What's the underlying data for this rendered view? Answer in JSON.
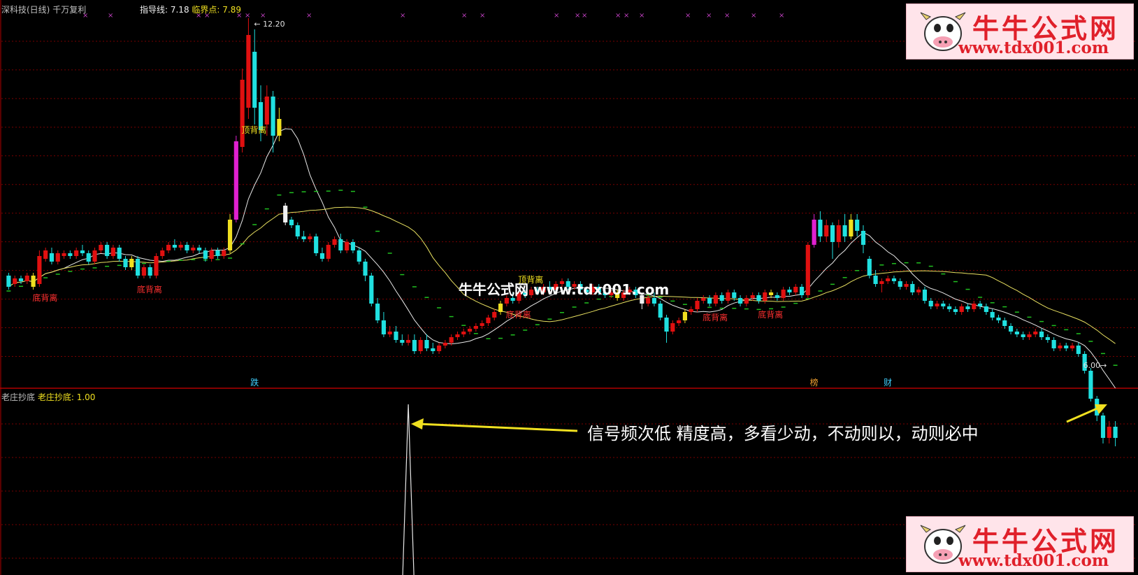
{
  "header": {
    "title": "深科技(日线)",
    "strategy": "千万复利",
    "guide_label": "指导线: 7.18",
    "critical_label": "临界点: 7.89"
  },
  "sub_panel": {
    "title": "老庄抄底",
    "indicator_label": "老庄抄底: 1.00"
  },
  "watermark": {
    "logo_cn": "牛牛公式网",
    "logo_url": "www.tdx001.com",
    "center_text": "牛牛公式网 www.tdx001.com"
  },
  "annotation_text": "信号频次低 精度高，多看少动，不动则以，动则必中",
  "colors": {
    "up": "#e01010",
    "down": "#20e0e0",
    "signal_yellow": "#f0e020",
    "signal_magenta": "#e020d0",
    "signal_white": "#f0f0f0",
    "ma_white": "#e8e8e8",
    "ma_yellow": "#e8e060",
    "ma_green": "#20c020",
    "grid": "#7a0000",
    "arrow": "#f0e020"
  },
  "chart_data": {
    "type": "candlestick",
    "price_range": [
      6.0,
      12.2
    ],
    "price_high_label": "12.20",
    "price_low_label": "6.00",
    "indicator_range": [
      0,
      1
    ],
    "indicator_values": [
      0,
      0,
      0,
      0,
      0,
      0,
      0,
      0,
      0,
      0,
      0,
      0,
      0,
      0,
      0,
      0,
      0,
      0,
      0,
      0,
      0,
      0,
      0,
      0,
      0,
      0,
      0,
      0,
      0,
      0,
      0,
      0,
      0,
      0,
      0,
      0,
      0,
      0,
      0,
      0,
      0,
      0,
      0,
      0,
      0,
      0,
      0,
      0,
      0,
      0,
      0,
      0,
      0,
      0,
      0,
      0,
      0,
      0,
      0,
      0,
      0,
      0,
      0,
      0,
      0,
      0,
      0,
      0,
      0,
      0,
      0,
      0,
      0,
      0,
      0,
      0,
      0,
      0,
      0,
      0,
      0,
      0,
      0,
      0,
      0,
      0,
      0,
      0,
      0,
      0,
      0,
      0,
      0,
      0,
      0,
      0,
      0,
      0,
      0,
      0,
      0,
      0,
      0,
      0,
      0,
      0,
      0,
      0,
      0,
      0,
      0,
      0,
      0,
      0,
      0,
      0,
      0,
      0,
      0,
      0,
      0,
      0,
      0,
      0,
      0,
      0,
      0,
      0,
      0,
      0,
      0,
      0,
      0,
      0,
      0,
      0,
      0,
      0,
      0,
      0,
      0,
      0,
      0,
      0,
      0,
      0,
      0,
      0,
      0,
      0,
      0,
      0,
      0,
      0,
      0,
      0,
      0,
      0,
      0,
      0,
      0,
      0,
      0,
      0,
      0,
      0,
      0,
      0,
      0,
      0,
      0,
      0,
      0,
      0,
      0,
      0,
      0,
      0,
      0,
      0,
      0,
      0,
      0,
      0,
      0,
      0,
      0,
      0,
      0,
      0,
      1
    ],
    "indicator_spikes": [
      65,
      186
    ],
    "candles": [
      [
        7.6,
        7.4,
        7.65,
        7.35
      ],
      [
        7.45,
        7.55,
        7.6,
        7.4
      ],
      [
        7.55,
        7.5,
        7.6,
        7.45
      ],
      [
        7.5,
        7.6,
        7.65,
        7.45
      ],
      [
        7.6,
        7.4,
        7.65,
        7.35
      ],
      [
        7.45,
        7.95,
        8.05,
        7.4
      ],
      [
        7.9,
        8.05,
        8.1,
        7.85
      ],
      [
        8.0,
        7.85,
        8.1,
        7.8
      ],
      [
        7.85,
        8.0,
        8.05,
        7.8
      ],
      [
        7.95,
        8.0,
        8.05,
        7.9
      ],
      [
        8.0,
        7.95,
        8.05,
        7.9
      ],
      [
        7.95,
        8.05,
        8.1,
        7.9
      ],
      [
        8.05,
        8.0,
        8.15,
        7.95
      ],
      [
        8.0,
        7.85,
        8.05,
        7.8
      ],
      [
        7.85,
        8.05,
        8.1,
        7.8
      ],
      [
        8.05,
        8.15,
        8.2,
        8.0
      ],
      [
        8.15,
        7.95,
        8.2,
        7.9
      ],
      [
        7.95,
        8.1,
        8.15,
        7.9
      ],
      [
        8.1,
        7.9,
        8.15,
        7.85
      ],
      [
        7.9,
        7.75,
        7.95,
        7.7
      ],
      [
        7.75,
        7.9,
        7.95,
        7.7
      ],
      [
        7.9,
        7.6,
        7.95,
        7.55
      ],
      [
        7.6,
        7.75,
        7.8,
        7.55
      ],
      [
        7.75,
        7.6,
        7.8,
        7.55
      ],
      [
        7.6,
        7.95,
        8.0,
        7.55
      ],
      [
        7.95,
        8.05,
        8.1,
        7.9
      ],
      [
        8.05,
        8.15,
        8.2,
        8.0
      ],
      [
        8.15,
        8.1,
        8.25,
        8.05
      ],
      [
        8.1,
        8.15,
        8.2,
        8.05
      ],
      [
        8.15,
        8.05,
        8.2,
        8.0
      ],
      [
        8.05,
        8.1,
        8.15,
        8.0
      ],
      [
        8.1,
        8.05,
        8.15,
        8.0
      ],
      [
        8.05,
        7.9,
        8.1,
        7.85
      ],
      [
        7.9,
        8.05,
        8.1,
        7.85
      ],
      [
        8.05,
        7.95,
        8.1,
        7.9
      ],
      [
        7.95,
        8.05,
        8.1,
        7.9
      ],
      [
        8.05,
        8.6,
        8.7,
        8.0
      ],
      [
        8.6,
        10.0,
        10.1,
        8.55
      ],
      [
        9.9,
        11.1,
        11.3,
        9.8
      ],
      [
        10.6,
        11.9,
        12.2,
        10.4
      ],
      [
        11.6,
        10.6,
        12.0,
        10.3
      ],
      [
        10.7,
        10.2,
        11.0,
        10.0
      ],
      [
        10.3,
        10.8,
        11.0,
        10.1
      ],
      [
        10.8,
        10.1,
        10.9,
        9.8
      ],
      [
        10.1,
        10.4,
        10.6,
        10.0
      ],
      [
        8.85,
        8.55,
        8.9,
        8.5
      ],
      [
        8.6,
        8.5,
        8.65,
        8.45
      ],
      [
        8.5,
        8.3,
        8.55,
        8.25
      ],
      [
        8.3,
        8.25,
        8.4,
        8.2
      ],
      [
        8.25,
        8.3,
        8.35,
        8.2
      ],
      [
        8.3,
        8.0,
        8.35,
        7.95
      ],
      [
        8.0,
        7.9,
        8.1,
        7.85
      ],
      [
        7.9,
        8.15,
        8.2,
        7.85
      ],
      [
        8.15,
        8.25,
        8.3,
        8.1
      ],
      [
        8.25,
        8.05,
        8.35,
        8.0
      ],
      [
        8.05,
        8.2,
        8.25,
        8.0
      ],
      [
        8.2,
        8.05,
        8.25,
        8.0
      ],
      [
        8.05,
        7.85,
        8.1,
        7.8
      ],
      [
        7.85,
        7.6,
        7.9,
        7.5
      ],
      [
        7.6,
        7.1,
        7.65,
        7.05
      ],
      [
        7.1,
        6.8,
        7.2,
        6.75
      ],
      [
        6.8,
        6.55,
        6.95,
        6.5
      ],
      [
        6.55,
        6.6,
        6.7,
        6.5
      ],
      [
        6.6,
        6.45,
        6.7,
        6.4
      ],
      [
        6.45,
        6.4,
        6.55,
        6.35
      ],
      [
        6.4,
        6.45,
        6.55,
        6.35
      ],
      [
        6.45,
        6.25,
        6.55,
        6.2
      ],
      [
        6.25,
        6.45,
        6.5,
        6.2
      ],
      [
        6.45,
        6.3,
        6.55,
        6.25
      ],
      [
        6.3,
        6.25,
        6.4,
        6.2
      ],
      [
        6.25,
        6.35,
        6.4,
        6.2
      ],
      [
        6.35,
        6.4,
        6.45,
        6.3
      ],
      [
        6.4,
        6.5,
        6.55,
        6.35
      ],
      [
        6.5,
        6.55,
        6.6,
        6.45
      ],
      [
        6.55,
        6.6,
        6.65,
        6.5
      ],
      [
        6.6,
        6.65,
        6.7,
        6.55
      ],
      [
        6.65,
        6.7,
        6.75,
        6.6
      ],
      [
        6.7,
        6.75,
        6.8,
        6.65
      ],
      [
        6.75,
        6.85,
        6.9,
        6.7
      ],
      [
        6.85,
        6.95,
        7.0,
        6.8
      ],
      [
        6.95,
        7.1,
        7.15,
        6.9
      ],
      [
        7.1,
        7.2,
        7.25,
        7.05
      ],
      [
        7.2,
        7.15,
        7.3,
        7.1
      ],
      [
        7.15,
        7.3,
        7.35,
        7.1
      ],
      [
        7.3,
        7.25,
        7.35,
        7.2
      ],
      [
        7.25,
        7.35,
        7.4,
        7.2
      ],
      [
        7.35,
        7.3,
        7.4,
        7.25
      ],
      [
        7.3,
        7.4,
        7.45,
        7.25
      ],
      [
        7.4,
        7.35,
        7.5,
        7.3
      ],
      [
        7.35,
        7.45,
        7.5,
        7.3
      ],
      [
        7.45,
        7.5,
        7.55,
        7.4
      ],
      [
        7.5,
        7.4,
        7.55,
        7.35
      ],
      [
        7.4,
        7.45,
        7.5,
        7.35
      ],
      [
        7.45,
        7.35,
        7.5,
        7.3
      ],
      [
        7.35,
        7.3,
        7.4,
        7.25
      ],
      [
        7.3,
        7.4,
        7.45,
        7.25
      ],
      [
        7.4,
        7.3,
        7.45,
        7.25
      ],
      [
        7.3,
        7.25,
        7.35,
        7.2
      ],
      [
        7.25,
        7.3,
        7.35,
        7.2
      ],
      [
        7.3,
        7.2,
        7.35,
        7.15
      ],
      [
        7.2,
        7.3,
        7.35,
        7.15
      ],
      [
        7.3,
        7.35,
        7.4,
        7.25
      ],
      [
        7.35,
        7.25,
        7.4,
        7.2
      ],
      [
        7.25,
        7.1,
        7.3,
        7.0
      ],
      [
        7.1,
        7.2,
        7.25,
        7.05
      ],
      [
        7.2,
        7.1,
        7.3,
        7.05
      ],
      [
        7.1,
        6.85,
        7.15,
        6.8
      ],
      [
        6.85,
        6.6,
        6.9,
        6.4
      ],
      [
        6.6,
        6.75,
        6.8,
        6.55
      ],
      [
        6.75,
        6.8,
        6.85,
        6.7
      ],
      [
        6.8,
        6.95,
        7.0,
        6.75
      ],
      [
        6.95,
        7.0,
        7.05,
        6.9
      ],
      [
        7.0,
        7.15,
        7.2,
        6.95
      ],
      [
        7.15,
        7.2,
        7.25,
        7.1
      ],
      [
        7.2,
        7.1,
        7.25,
        7.05
      ],
      [
        7.1,
        7.25,
        7.3,
        7.05
      ],
      [
        7.25,
        7.15,
        7.3,
        7.1
      ],
      [
        7.15,
        7.3,
        7.35,
        7.1
      ],
      [
        7.3,
        7.2,
        7.35,
        7.15
      ],
      [
        7.2,
        7.1,
        7.25,
        7.05
      ],
      [
        7.1,
        7.2,
        7.25,
        7.05
      ],
      [
        7.2,
        7.25,
        7.3,
        7.15
      ],
      [
        7.25,
        7.15,
        7.3,
        7.1
      ],
      [
        7.15,
        7.3,
        7.35,
        7.1
      ],
      [
        7.3,
        7.25,
        7.35,
        7.2
      ],
      [
        7.25,
        7.2,
        7.3,
        7.15
      ],
      [
        7.2,
        7.35,
        7.4,
        7.15
      ],
      [
        7.35,
        7.3,
        7.4,
        7.25
      ],
      [
        7.3,
        7.4,
        7.45,
        7.25
      ],
      [
        7.4,
        7.25,
        7.45,
        7.2
      ],
      [
        7.25,
        8.15,
        8.2,
        7.2
      ],
      [
        8.15,
        8.6,
        8.7,
        8.1
      ],
      [
        8.6,
        8.3,
        8.75,
        8.2
      ],
      [
        8.3,
        8.5,
        8.6,
        8.2
      ],
      [
        8.5,
        8.2,
        8.55,
        7.9
      ],
      [
        8.2,
        8.5,
        8.6,
        8.1
      ],
      [
        8.5,
        8.3,
        8.7,
        8.2
      ],
      [
        8.3,
        8.6,
        8.7,
        8.25
      ],
      [
        8.6,
        8.4,
        8.7,
        8.3
      ],
      [
        8.4,
        8.15,
        8.5,
        8.0
      ],
      [
        7.9,
        7.6,
        7.95,
        7.55
      ],
      [
        7.6,
        7.45,
        7.7,
        7.4
      ],
      [
        7.45,
        7.5,
        7.55,
        7.3
      ],
      [
        7.5,
        7.55,
        7.6,
        7.45
      ],
      [
        7.55,
        7.5,
        7.6,
        7.45
      ],
      [
        7.5,
        7.4,
        7.55,
        7.35
      ],
      [
        7.4,
        7.45,
        7.5,
        7.35
      ],
      [
        7.45,
        7.3,
        7.5,
        7.25
      ],
      [
        7.3,
        7.35,
        7.4,
        7.25
      ],
      [
        7.35,
        7.15,
        7.4,
        7.1
      ],
      [
        7.15,
        7.05,
        7.2,
        7.0
      ],
      [
        7.05,
        7.1,
        7.15,
        7.0
      ],
      [
        7.1,
        7.05,
        7.15,
        7.0
      ],
      [
        7.05,
        7.0,
        7.1,
        6.95
      ],
      [
        7.0,
        6.95,
        7.05,
        6.9
      ],
      [
        6.95,
        7.05,
        7.1,
        6.9
      ],
      [
        7.05,
        7.0,
        7.1,
        6.95
      ],
      [
        7.0,
        7.1,
        7.15,
        6.95
      ],
      [
        7.1,
        7.05,
        7.15,
        7.0
      ],
      [
        7.05,
        6.95,
        7.1,
        6.9
      ],
      [
        6.95,
        6.85,
        7.0,
        6.8
      ],
      [
        6.85,
        6.8,
        6.9,
        6.75
      ],
      [
        6.8,
        6.7,
        6.85,
        6.65
      ],
      [
        6.7,
        6.6,
        6.75,
        6.55
      ],
      [
        6.6,
        6.55,
        6.65,
        6.5
      ],
      [
        6.55,
        6.5,
        6.6,
        6.45
      ],
      [
        6.5,
        6.55,
        6.6,
        6.45
      ],
      [
        6.55,
        6.6,
        6.65,
        6.5
      ],
      [
        6.6,
        6.5,
        6.65,
        6.45
      ],
      [
        6.5,
        6.45,
        6.55,
        6.4
      ],
      [
        6.45,
        6.3,
        6.5,
        6.25
      ],
      [
        6.3,
        6.35,
        6.4,
        6.25
      ],
      [
        6.35,
        6.3,
        6.4,
        6.25
      ],
      [
        6.3,
        6.35,
        6.4,
        6.25
      ],
      [
        6.35,
        6.2,
        6.4,
        6.15
      ],
      [
        6.2,
        5.9,
        6.25,
        5.85
      ],
      [
        5.9,
        5.4,
        5.95,
        5.35
      ],
      [
        5.4,
        5.1,
        5.45,
        5.0
      ],
      [
        5.1,
        4.7,
        5.15,
        4.6
      ],
      [
        4.7,
        4.9,
        5.0,
        4.6
      ],
      [
        4.9,
        4.7,
        5.0,
        4.55
      ]
    ],
    "signal_bars": {
      "yellow": [
        4,
        20,
        36,
        44,
        80,
        99,
        110,
        124,
        137
      ],
      "magenta": [
        37,
        131
      ],
      "white": [
        45,
        103
      ]
    },
    "annotations": [
      {
        "text": "底背离",
        "at": 5,
        "pos": "below"
      },
      {
        "text": "底背离",
        "at": 22,
        "pos": "below"
      },
      {
        "text": "顶背离",
        "at": 39,
        "pos": "below"
      },
      {
        "text": "顶背离",
        "at": 84,
        "pos": "above"
      },
      {
        "text": "底背离",
        "at": 82,
        "pos": "below"
      },
      {
        "text": "底背离",
        "at": 114,
        "pos": "below"
      },
      {
        "text": "底背离",
        "at": 123,
        "pos": "below"
      }
    ],
    "bottom_markers": [
      {
        "text": "跌",
        "at": 40
      },
      {
        "text": "榜",
        "at": 131
      },
      {
        "text": "财",
        "at": 143
      }
    ]
  }
}
